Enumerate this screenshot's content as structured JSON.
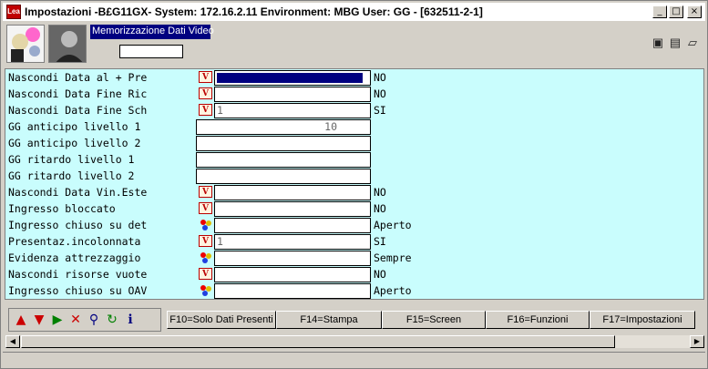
{
  "window": {
    "app_icon": "app-logo",
    "title": "Impostazioni -B£G11GX- System: 172.16.2.11 Environment: MBG User: GG - [632511-2-1]",
    "controls": {
      "minimize": "_",
      "maximize": "□",
      "close": "×"
    }
  },
  "header": {
    "panel_title": "Memorizzazione Dati Video",
    "panel_input_value": "",
    "right_icons": [
      "monitor-icon",
      "document-list-icon",
      "folder-icon"
    ]
  },
  "rows": [
    {
      "label": "Nascondi Data al + Pre",
      "icon": "vm",
      "field": "",
      "value": "NO",
      "type": "short",
      "selected": true
    },
    {
      "label": "Nascondi Data Fine Ric",
      "icon": "vm",
      "field": "",
      "value": "NO",
      "type": "short"
    },
    {
      "label": "Nascondi Data Fine Sch",
      "icon": "vm",
      "field": "1",
      "value": "SI",
      "type": "short"
    },
    {
      "label": "GG anticipo livello 1",
      "icon": "",
      "field": "10",
      "value": "",
      "type": "long"
    },
    {
      "label": "GG anticipo livello 2",
      "icon": "",
      "field": "",
      "value": "",
      "type": "long"
    },
    {
      "label": "GG ritardo  livello 1",
      "icon": "",
      "field": "",
      "value": "",
      "type": "long"
    },
    {
      "label": "GG ritardo  livello 2",
      "icon": "",
      "field": "",
      "value": "",
      "type": "long"
    },
    {
      "label": "Nascondi Data Vin.Este",
      "icon": "vm",
      "field": "",
      "value": "NO",
      "type": "short"
    },
    {
      "label": "Ingresso bloccato",
      "icon": "vm",
      "field": "",
      "value": "NO",
      "type": "short"
    },
    {
      "label": "Ingresso chiuso su det",
      "icon": "balls",
      "field": "",
      "value": "Aperto",
      "type": "short"
    },
    {
      "label": "Presentaz.incolonnata",
      "icon": "vm",
      "field": "1",
      "value": "SI",
      "type": "short"
    },
    {
      "label": "Evidenza attrezzaggio",
      "icon": "balls",
      "field": "",
      "value": "Sempre",
      "type": "short"
    },
    {
      "label": "Nascondi risorse vuote",
      "icon": "vm",
      "field": "",
      "value": "NO",
      "type": "short"
    },
    {
      "label": "Ingresso chiuso su OAV",
      "icon": "balls",
      "field": "",
      "value": "Aperto",
      "type": "short"
    }
  ],
  "nav_buttons": [
    {
      "name": "move-up-icon",
      "glyph": "▲",
      "color": "#cc0000"
    },
    {
      "name": "move-down-icon",
      "glyph": "▼",
      "color": "#cc0000"
    },
    {
      "name": "play-icon",
      "glyph": "▶",
      "color": "#008000"
    },
    {
      "name": "delete-icon",
      "glyph": "✕",
      "color": "#cc0000"
    },
    {
      "name": "search-icon",
      "glyph": "⚲",
      "color": "#000080"
    },
    {
      "name": "refresh-icon",
      "glyph": "↻",
      "color": "#008000"
    },
    {
      "name": "info-icon",
      "glyph": "ℹ",
      "color": "#000080"
    }
  ],
  "function_keys": [
    {
      "label": "F10=Solo Dati Presenti"
    },
    {
      "label": "F14=Stampa"
    },
    {
      "label": "F15=Screen"
    },
    {
      "label": "F16=Funzioni"
    },
    {
      "label": "F17=Impostazioni"
    }
  ],
  "colors": {
    "grid_bg": "#c9fdfd",
    "title_panel": "#000080",
    "accent_red": "#cc0000"
  }
}
